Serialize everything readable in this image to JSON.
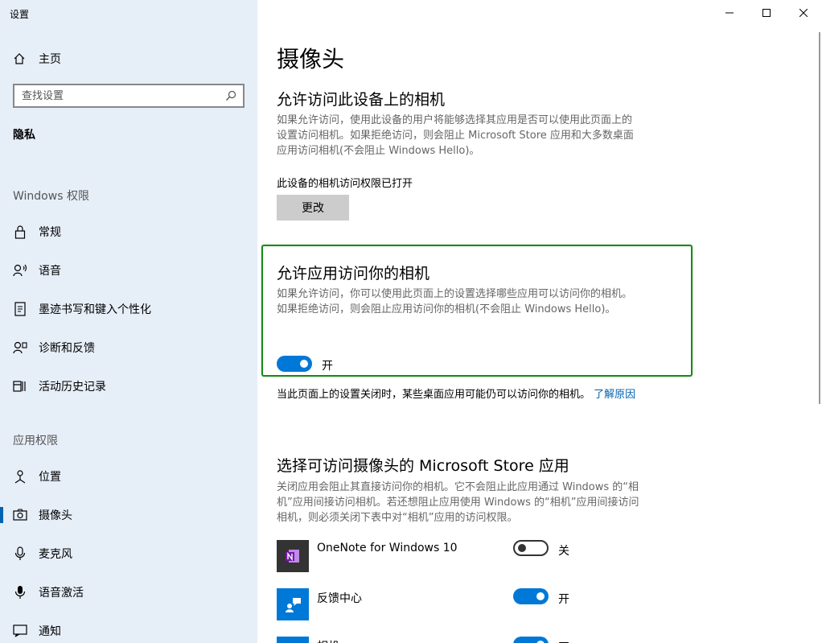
{
  "window": {
    "title": "设置"
  },
  "sidebar": {
    "home_label": "主页",
    "search_placeholder": "查找设置",
    "current_section": "隐私",
    "windows_permissions_header": "Windows 权限",
    "windows_items": [
      {
        "label": "常规",
        "icon": "lock-icon"
      },
      {
        "label": "语音",
        "icon": "speech-icon"
      },
      {
        "label": "墨迹书写和键入个性化",
        "icon": "inking-icon"
      },
      {
        "label": "诊断和反馈",
        "icon": "diagnostics-icon"
      },
      {
        "label": "活动历史记录",
        "icon": "activity-history-icon"
      }
    ],
    "app_permissions_header": "应用权限",
    "app_items": [
      {
        "label": "位置",
        "icon": "location-icon"
      },
      {
        "label": "摄像头",
        "icon": "camera-icon",
        "active": true
      },
      {
        "label": "麦克风",
        "icon": "microphone-icon"
      },
      {
        "label": "语音激活",
        "icon": "voice-activation-icon"
      },
      {
        "label": "通知",
        "icon": "notification-icon"
      }
    ]
  },
  "main": {
    "title": "摄像头",
    "device_access": {
      "heading": "允许访问此设备上的相机",
      "description": "如果允许访问，使用此设备的用户将能够选择其应用是否可以使用此页面上的设置访问相机。如果拒绝访问，则会阻止 Microsoft Store 应用和大多数桌面应用访问相机(不会阻止 Windows Hello)。",
      "status": "此设备的相机访问权限已打开",
      "change_button": "更改"
    },
    "app_access": {
      "heading": "允许应用访问你的相机",
      "description": "如果允许访问，你可以使用此页面上的设置选择哪些应用可以访问你的相机。如果拒绝访问，则会阻止应用访问你的相机(不会阻止 Windows Hello)。",
      "toggle_state": "开"
    },
    "note": {
      "text": "当此页面上的设置关闭时，某些桌面应用可能仍可以访问你的相机。",
      "link": "了解原因"
    },
    "store_apps": {
      "heading": "选择可访问摄像头的 Microsoft Store 应用",
      "description": "关闭应用会阻止其直接访问你的相机。它不会阻止此应用通过 Windows 的“相机”应用间接访问相机。若还想阻止应用使用 Windows 的“相机”应用间接访问相机，则必须关闭下表中对“相机”应用的访问权限。",
      "apps": [
        {
          "name": "OneNote for Windows 10",
          "state": "关",
          "on": false
        },
        {
          "name": "反馈中心",
          "state": "开",
          "on": true
        },
        {
          "name": "相机",
          "state": "开",
          "on": true
        }
      ]
    }
  },
  "colors": {
    "accent": "#0078d7",
    "sidebar_bg": "#e6eef8",
    "highlight_border": "#1a8a1a"
  }
}
